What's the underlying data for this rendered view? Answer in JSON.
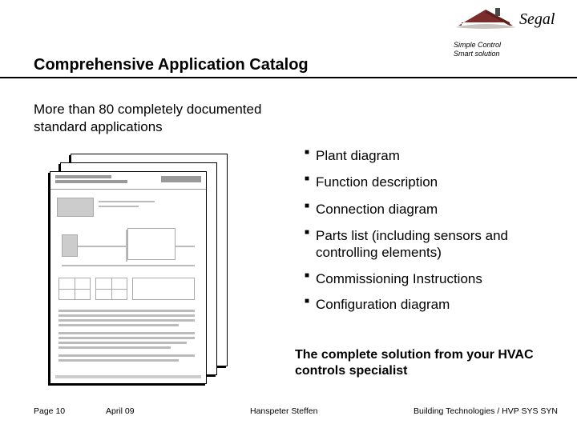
{
  "logo": {
    "brand": "Segal",
    "tagline_line1": "Simple Control",
    "tagline_line2": "Smart solution",
    "roof_color": "#7a2d2a",
    "chimney_color": "#4a4a4a"
  },
  "title": "Comprehensive Application Catalog",
  "intro": "More than 80 completely documented standard applications",
  "bullets": [
    "Plant diagram",
    "Function description",
    "Connection diagram",
    "Parts list (including sensors and controlling elements)",
    "Commissioning Instructions",
    "Configuration diagram"
  ],
  "closing": "The complete solution from your HVAC controls specialist",
  "footer": {
    "page": "Page 10",
    "date": "April 09",
    "author": "Hanspeter Steffen",
    "org": "Building Technologies / HVP SYS SYN"
  }
}
